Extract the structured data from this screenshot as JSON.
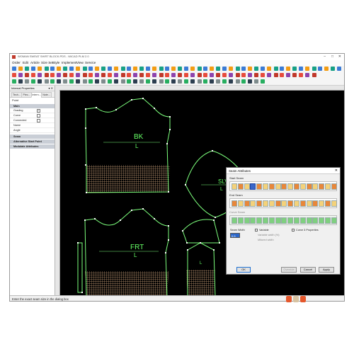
{
  "window": {
    "title": "WOMAN SWEAT SHIRT BLOCK.PDS - WICAD PLM 2.0",
    "controls": [
      "–",
      "□",
      "✕"
    ]
  },
  "menu": [
    "Order",
    "Edit",
    "Article",
    "Size Set",
    "Style",
    "Implement",
    "View",
    "Service"
  ],
  "left_panel": {
    "header": "Internal Properties",
    "pin": "▾ ✕",
    "tabs": [
      "Tech...",
      "Piec...",
      "Intern...",
      "Note..."
    ],
    "active_tab": 2,
    "section": "Point",
    "main_group": "Main",
    "properties": [
      {
        "name": "Grading",
        "checked": true,
        "mark": "✓"
      },
      {
        "name": "Curve",
        "checked": false,
        "mark": ""
      },
      {
        "name": "Connected",
        "checked": false,
        "mark": ""
      },
      {
        "name": "Name",
        "checked": null,
        "mark": ""
      },
      {
        "name": "Angle",
        "checked": null,
        "mark": ""
      }
    ],
    "groups": [
      "Seam",
      "Alternative Start Point",
      "Modulate Attributes"
    ]
  },
  "canvas": {
    "pieces": {
      "back": {
        "name": "BK",
        "size": "L"
      },
      "sleeve": {
        "name": "SLV",
        "size": "L"
      },
      "front": {
        "name": "FRT",
        "size": "L"
      },
      "piece_l": "L"
    },
    "colors": {
      "outline": "#7cff7c",
      "text": "#66ff66",
      "hatch": "#d7b08a",
      "points": "#ffffff"
    }
  },
  "status": "Enter the exact seam size in the dialog box",
  "dialog": {
    "title": "Seam Attributes",
    "close": "✕",
    "start_seam": "Start Seam",
    "end_seam": "End Seam",
    "curve_seam": "Curve Seam",
    "seam_width_label": "Seam Width",
    "seam_width_value": "0.5",
    "variable_label": "Variable",
    "curve_props_label": "Curve 3 Properties",
    "variable_width_label": "Variable width (%)",
    "miniuf_label": "Mitured width",
    "buttons": {
      "ok": "OK",
      "override": "Override",
      "cancel": "Cancel",
      "apply": "Apply"
    }
  }
}
